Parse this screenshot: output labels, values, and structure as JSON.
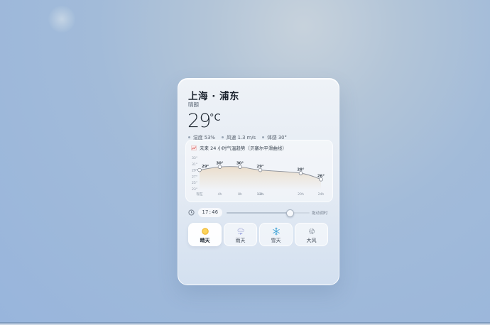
{
  "location": {
    "city": "上海 · 浦东"
  },
  "current": {
    "condition": "晴朗",
    "temp": "29",
    "unit": "°C",
    "humidity": "湿度 53%",
    "wind": "风速 1.3 m/s",
    "feels_like": "体感 30°"
  },
  "chart_data": {
    "type": "line",
    "title": "未来 24 小时气温趋势（贝塞尔平滑曲线）",
    "x": [
      "现在",
      "4h",
      "8h",
      "12h",
      "20h",
      "24h"
    ],
    "series": [
      {
        "values": [
          29,
          30,
          30,
          29,
          28,
          26
        ]
      }
    ],
    "y_ticks": [
      "33°",
      "31°",
      "29°",
      "27°",
      "25°",
      "23°"
    ],
    "point_labels": [
      "29°",
      "30°",
      "30°",
      "29°",
      "28°",
      "26°"
    ],
    "ylim": [
      23,
      33
    ],
    "grid": false,
    "colors": {
      "line": "#8a8f98",
      "fill": "#e9d9c3"
    }
  },
  "timeline": {
    "time": "17:46",
    "hint": "拖动调时",
    "value_fraction": 0.76
  },
  "weather_types": [
    {
      "label": "晴天",
      "icon": "sun-icon",
      "active": true
    },
    {
      "label": "雨天",
      "icon": "rain-icon",
      "active": false
    },
    {
      "label": "雪天",
      "icon": "snowflake-icon",
      "active": false
    },
    {
      "label": "大风",
      "icon": "wind-icon",
      "active": false
    }
  ],
  "colors": {
    "sun": "#f5c542",
    "snow": "#4aa8d8",
    "rain": "#8a93d9"
  }
}
